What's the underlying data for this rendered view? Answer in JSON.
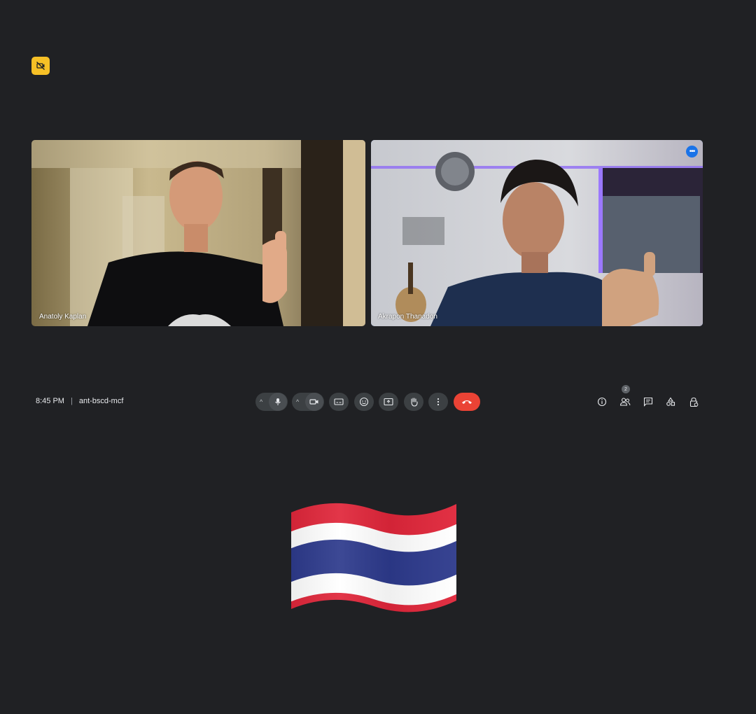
{
  "top_badge": {
    "icon": "no-camera-icon",
    "color": "#f6c026"
  },
  "participants": [
    {
      "name": "Anatoly Kaplan"
    },
    {
      "name": "Akrapon Thanadon",
      "more_icon": "more-horiz-icon",
      "more_label": "•••"
    }
  ],
  "bottom_bar": {
    "time": "8:45 PM",
    "meeting_code": "ant-bscd-mcf",
    "controls": [
      {
        "name": "microphone",
        "icon": "mic-icon"
      },
      {
        "name": "camera",
        "icon": "camera-icon"
      },
      {
        "name": "captions",
        "icon": "captions-icon"
      },
      {
        "name": "reactions",
        "icon": "emoji-icon"
      },
      {
        "name": "present",
        "icon": "present-icon"
      },
      {
        "name": "raise-hand",
        "icon": "hand-icon"
      },
      {
        "name": "more-options",
        "icon": "more-vert-icon"
      },
      {
        "name": "leave-call",
        "icon": "call-end-icon",
        "color": "#ea4335"
      }
    ],
    "right_controls": [
      {
        "name": "meeting-details",
        "icon": "info-icon"
      },
      {
        "name": "people",
        "icon": "people-icon",
        "count": "2"
      },
      {
        "name": "chat",
        "icon": "chat-icon"
      },
      {
        "name": "activities",
        "icon": "activities-icon"
      },
      {
        "name": "host-controls",
        "icon": "lock-person-icon"
      }
    ]
  },
  "overlay": {
    "emoji": "thailand-flag",
    "colors": [
      "#e0263a",
      "#ffffff",
      "#2d3a8c"
    ]
  }
}
